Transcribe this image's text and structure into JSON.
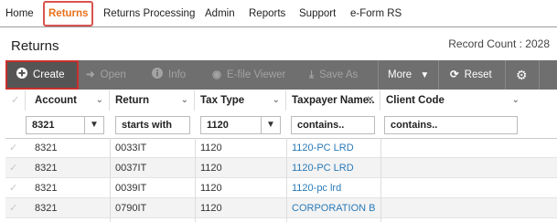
{
  "nav": {
    "items": [
      {
        "label": "Home"
      },
      {
        "label": "Returns"
      },
      {
        "label": "Returns Processing"
      },
      {
        "label": "Admin"
      },
      {
        "label": "Reports"
      },
      {
        "label": "Support"
      },
      {
        "label": "e-Form RS"
      }
    ],
    "active_index": 1
  },
  "page": {
    "title": "Returns",
    "record_count": "Record Count : 2028"
  },
  "toolbar": {
    "create_label": "Create",
    "open_label": "Open",
    "info_label": "Info",
    "efile_label": "E-file Viewer",
    "saveas_label": "Save As",
    "more_label": "More",
    "reset_label": "Reset",
    "icons": {
      "create": "plus-circle-icon",
      "open": "sign-in-icon",
      "info": "info-icon",
      "efile": "eye-icon",
      "saveas": "download-icon",
      "more": "chevron-down-icon",
      "reset": "refresh-icon",
      "settings": "gear-icon"
    }
  },
  "grid": {
    "columns": [
      {
        "label": "Account"
      },
      {
        "label": "Return"
      },
      {
        "label": "Tax Type"
      },
      {
        "label": "Taxpayer Name.."
      },
      {
        "label": "Client Code"
      }
    ],
    "filters": {
      "account": "8321",
      "return": "starts with",
      "tax_type": "1120",
      "taxpayer_name": "contains..",
      "client_code": "contains.."
    },
    "rows": [
      {
        "account": "8321",
        "return": "0033IT",
        "tax_type": "1120",
        "taxpayer": "1120-PC LRD",
        "client": ""
      },
      {
        "account": "8321",
        "return": "0037IT",
        "tax_type": "1120",
        "taxpayer": "1120-PC LRD",
        "client": ""
      },
      {
        "account": "8321",
        "return": "0039IT",
        "tax_type": "1120",
        "taxpayer": "1120-pc lrd",
        "client": ""
      },
      {
        "account": "8321",
        "return": "0790IT",
        "tax_type": "1120",
        "taxpayer": "CORPORATION B",
        "client": ""
      }
    ]
  },
  "colors": {
    "toolbar_bg": "#6f6f6f",
    "active_nav": "#e8701a",
    "highlight_border": "#d9534f",
    "link": "#2a7ab8"
  }
}
